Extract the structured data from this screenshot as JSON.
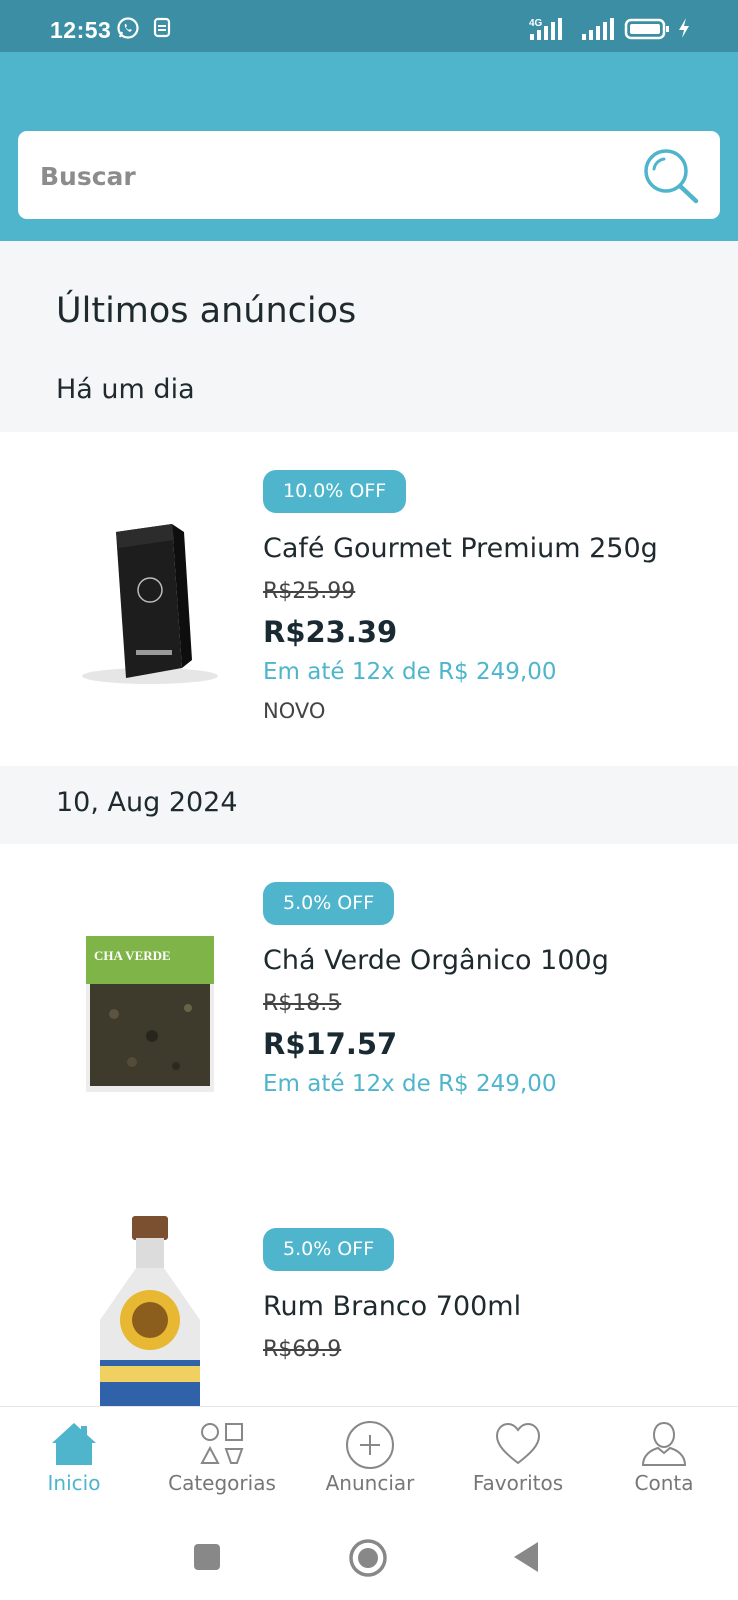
{
  "status_bar": {
    "time": "12:53",
    "network": "4G",
    "icons": [
      "whatsapp-icon",
      "notification-icon",
      "signal-icon",
      "battery-icon",
      "charging-icon"
    ]
  },
  "search": {
    "placeholder": "Buscar",
    "icon": "search-icon"
  },
  "main": {
    "section_title": "Últimos anúncios",
    "groups": [
      {
        "date_label": "Há um dia",
        "items": [
          {
            "discount": "10.0% OFF",
            "title": "Café Gourmet Premium 250g",
            "old_price": "R$25.99",
            "price": "R$23.39",
            "installments": "Em até 12x de R$ 249,00",
            "condition": "NOVO",
            "image": "coffee-bag-image"
          }
        ]
      },
      {
        "date_label": "10, Aug 2024",
        "items": [
          {
            "discount": "5.0% OFF",
            "title": "Chá Verde Orgânico 100g",
            "old_price": "R$18.5",
            "price": "R$17.57",
            "installments": "Em até 12x de R$ 249,00",
            "image": "green-tea-bag-image",
            "image_label": "CHA VERDE"
          },
          {
            "discount": "5.0% OFF",
            "title": "Rum Branco 700ml",
            "old_price": "R$69.9",
            "image": "rum-bottle-image"
          }
        ]
      }
    ]
  },
  "bottom_nav": {
    "items": [
      {
        "label": "Inicio",
        "icon": "home-icon",
        "active": true
      },
      {
        "label": "Categorias",
        "icon": "categories-icon",
        "active": false
      },
      {
        "label": "Anunciar",
        "icon": "add-circle-icon",
        "active": false
      },
      {
        "label": "Favoritos",
        "icon": "heart-icon",
        "active": false
      },
      {
        "label": "Conta",
        "icon": "user-icon",
        "active": false
      }
    ]
  },
  "android_nav": {
    "buttons": [
      "recents-button",
      "home-button",
      "back-button"
    ]
  },
  "colors": {
    "status_bar": "#3b8ea3",
    "accent": "#4eb5cc",
    "background": "#f5f6f8",
    "card": "#ffffff"
  }
}
